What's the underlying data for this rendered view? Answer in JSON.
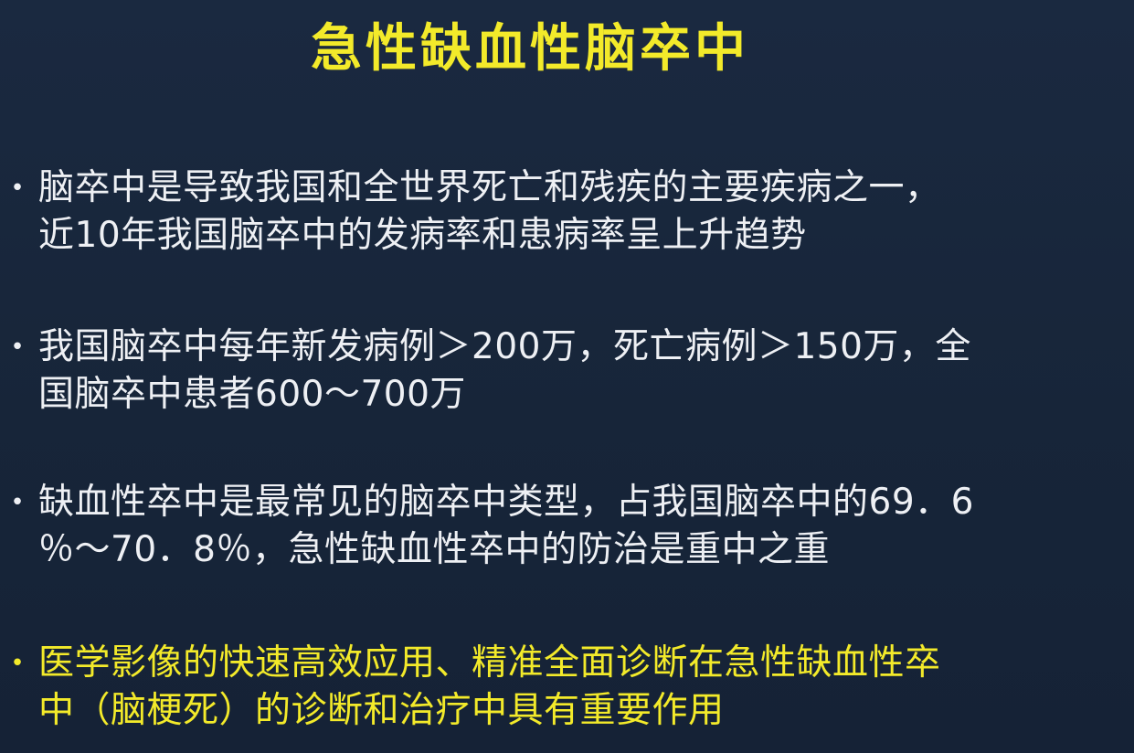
{
  "slide": {
    "title": "急性缺血性脑卒中",
    "bullets": [
      {
        "marker": "•",
        "text": "脑卒中是导致我国和全世界死亡和残疾的主要疾病之一，\n近10年我国脑卒中的发病率和患病率呈上升趋势",
        "color": "#eef0f4"
      },
      {
        "marker": "•",
        "text": "我国脑卒中每年新发病例＞200万，死亡病例＞150万，全\n国脑卒中患者600～700万",
        "color": "#eef0f4"
      },
      {
        "marker": "•",
        "text": "缺血性卒中是最常见的脑卒中类型，占我国脑卒中的69．6\n％～70．8％，急性缺血性卒中的防治是重中之重",
        "color": "#eef0f4"
      },
      {
        "marker": "•",
        "text": "医学影像的快速高效应用、精准全面诊断在急性缺血性卒\n中（脑梗死）的诊断和治疗中具有重要作用",
        "color": "#f3ea2a"
      }
    ]
  },
  "colors": {
    "background": "#172539",
    "title": "#f3ea2a",
    "body_text": "#eef0f4",
    "highlight_text": "#f3ea2a"
  }
}
